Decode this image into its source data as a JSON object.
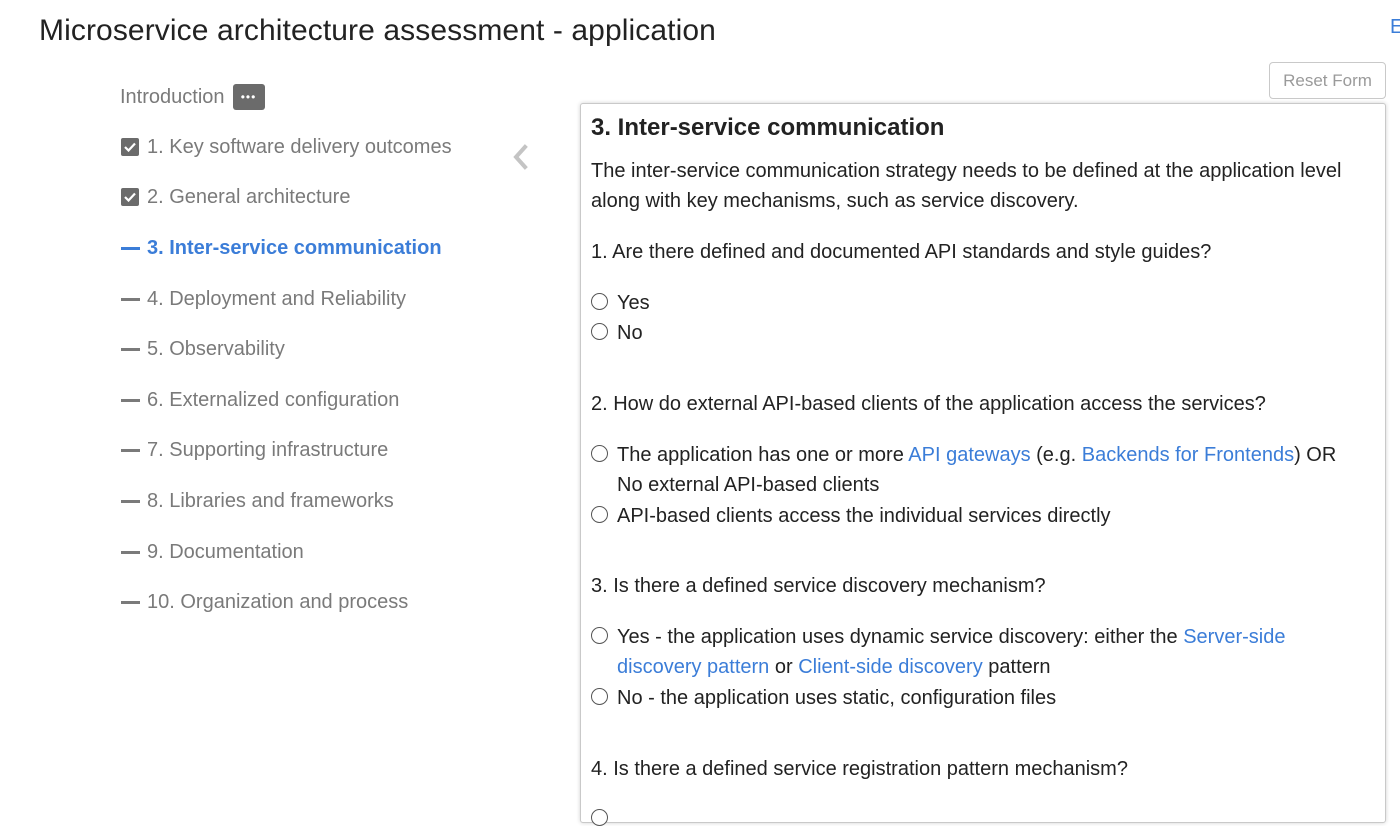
{
  "page": {
    "title": "Microservice architecture assessment - application",
    "edge_link": "E",
    "reset_label": "Reset Form"
  },
  "sidebar": {
    "intro_label": "Introduction",
    "more_label": "•••",
    "items": [
      {
        "label": "1. Key software delivery outcomes",
        "status": "checked"
      },
      {
        "label": "2. General architecture",
        "status": "checked"
      },
      {
        "label": "3. Inter-service communication",
        "status": "active"
      },
      {
        "label": "4. Deployment and Reliability",
        "status": "incomplete"
      },
      {
        "label": "5. Observability",
        "status": "incomplete"
      },
      {
        "label": "6. Externalized configuration",
        "status": "incomplete"
      },
      {
        "label": "7. Supporting infrastructure",
        "status": "incomplete"
      },
      {
        "label": "8. Libraries and frameworks",
        "status": "incomplete"
      },
      {
        "label": "9. Documentation",
        "status": "incomplete"
      },
      {
        "label": "10. Organization and process",
        "status": "incomplete"
      }
    ]
  },
  "section": {
    "title": "3. Inter-service communication",
    "description_line1": "The inter-service communication strategy needs to be defined at the application level",
    "description_line2": "along with key mechanisms, such as service discovery.",
    "q1": {
      "text": "1. Are there defined and documented API standards and style guides?",
      "opt_yes": "Yes",
      "opt_no": "No"
    },
    "q2": {
      "text": "2. How do external API-based clients of the application access the services?",
      "opt1_a": "The application has one or more ",
      "opt1_link1": "API gateways",
      "opt1_b": " (e.g. ",
      "opt1_link2": "Backends for Frontends",
      "opt1_c": ") OR",
      "opt1_line2": "No external API-based clients",
      "opt2": "API-based clients access the individual services directly"
    },
    "q3": {
      "text": "3. Is there a defined service discovery mechanism?",
      "opt1_a": "Yes - the application uses dynamic service discovery: either the ",
      "opt1_link1": "Server-side",
      "opt1_link1b": "discovery pattern",
      "opt1_b": " or ",
      "opt1_link2": "Client-side discovery",
      "opt1_c": " pattern",
      "opt2": "No - the application uses static, configuration files"
    },
    "q4": {
      "text": "4. Is there a defined service registration pattern mechanism?"
    }
  },
  "colors": {
    "accent": "#3b7dd8",
    "muted_text": "#7a7a7a",
    "checkbox": "#6b6b6b"
  }
}
